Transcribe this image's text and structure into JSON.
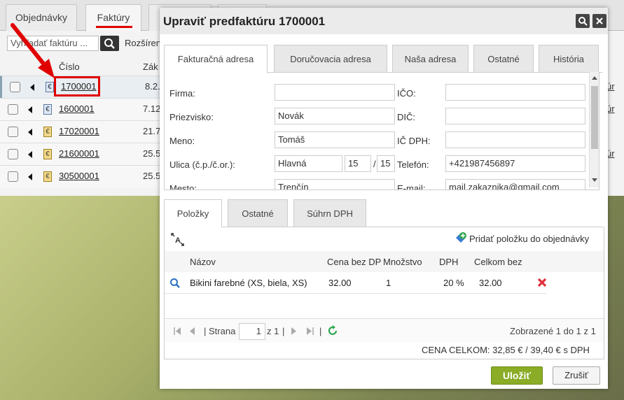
{
  "main_tabs": [
    "Objednávky",
    "Faktúry"
  ],
  "search": {
    "placeholder": "Vyhľadať faktúru ...",
    "extended_label": "Rozšírené"
  },
  "table": {
    "col_cislo": "Číslo",
    "col_zak": "Zák",
    "rows": [
      {
        "number": "1700001",
        "date": "8.2.",
        "currency": "eur-blue"
      },
      {
        "number": "1600001",
        "date": "7.12",
        "currency": "eur-blue"
      },
      {
        "number": "17020001",
        "date": "21.7",
        "currency": "eur-yellow"
      },
      {
        "number": "21600001",
        "date": "25.5",
        "currency": "eur-yellow"
      },
      {
        "number": "30500001",
        "date": "25.5",
        "currency": "eur-yellow"
      }
    ],
    "right_fragment": "úr"
  },
  "dialog": {
    "title": "Upraviť predfaktúru 1700001",
    "address_tabs": [
      "Fakturačná adresa",
      "Doručovacia adresa",
      "Naša adresa",
      "Ostatné",
      "História"
    ],
    "fields": {
      "firma_label": "Firma:",
      "firma": "",
      "priezvisko_label": "Priezvisko:",
      "priezvisko": "Novák",
      "meno_label": "Meno:",
      "meno": "Tomáš",
      "ulica_label": "Ulica (č.p./č.or.):",
      "ulica": "Hlavná",
      "cp": "15",
      "cor": "15",
      "mesto_label": "Mesto:",
      "mesto": "Trenčín",
      "ico_label": "IČO:",
      "ico": "",
      "dic_label": "DIČ:",
      "dic": "",
      "icdph_label": "IČ DPH:",
      "icdph": "",
      "telefon_label": "Telefón:",
      "telefon": "+421987456897",
      "email_label": "E-mail:",
      "email": "mail.zakaznika@gmail.com"
    },
    "item_tabs": [
      "Položky",
      "Ostatné",
      "Súhrn DPH"
    ],
    "add_item_label": "Pridať položku do objednávky",
    "grid": {
      "headers": {
        "nazov": "Názov",
        "cena": "Cena bez DP",
        "mnozstvo": "Množstvo",
        "dph": "DPH",
        "celkom": "Celkom bez"
      },
      "rows": [
        {
          "nazov": "Bikini farebné (XS, biela, XS)",
          "cena": "32.00",
          "mnozstvo": "1",
          "dph": "20 %",
          "celkom": "32.00"
        }
      ]
    },
    "pager": {
      "strana_label": "Strana",
      "page": "1",
      "of_label": "z 1",
      "summary": "Zobrazené 1 do 1 z 1"
    },
    "total": "CENA CELKOM: 32,85 € / 39,40 € s DPH",
    "save_label": "Uložiť",
    "cancel_label": "Zrušiť"
  },
  "colors": {
    "accent_red": "#e00000",
    "save_green": "#8aac26"
  }
}
